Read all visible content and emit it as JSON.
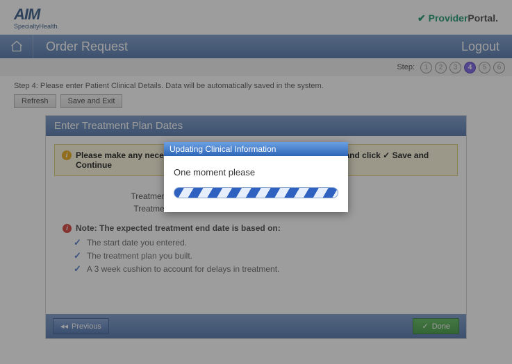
{
  "brand": {
    "main": "AIM",
    "sub": "SpecialtyHealth.",
    "portal_provider": "Provider",
    "portal_portal": "Portal."
  },
  "nav": {
    "title": "Order Request",
    "logout": "Logout"
  },
  "steps": {
    "label": "Step:",
    "items": [
      "1",
      "2",
      "3",
      "4",
      "5",
      "6"
    ],
    "active_index": 3
  },
  "instruction": "Step 4: Please enter Patient Clinical Details. Data will be automatically saved in the system.",
  "buttons": {
    "refresh": "Refresh",
    "save_exit": "Save and Exit",
    "previous": "Previous",
    "done": "Done"
  },
  "panel": {
    "title": "Enter Treatment Plan Dates",
    "notice": "Please make any necessary adjustments to the Treatment End Date and click ✓ Save and Continue",
    "form": {
      "start_label": "Treatment Start Date",
      "end_label": "Treatment End Date"
    },
    "note_head": "Note: The expected treatment end date is based on:",
    "note_items": [
      "The start date you entered.",
      "The treatment plan you built.",
      "A 3 week cushion to account for delays in treatment."
    ]
  },
  "modal": {
    "title": "Updating Clinical Information",
    "message": "One moment please"
  }
}
